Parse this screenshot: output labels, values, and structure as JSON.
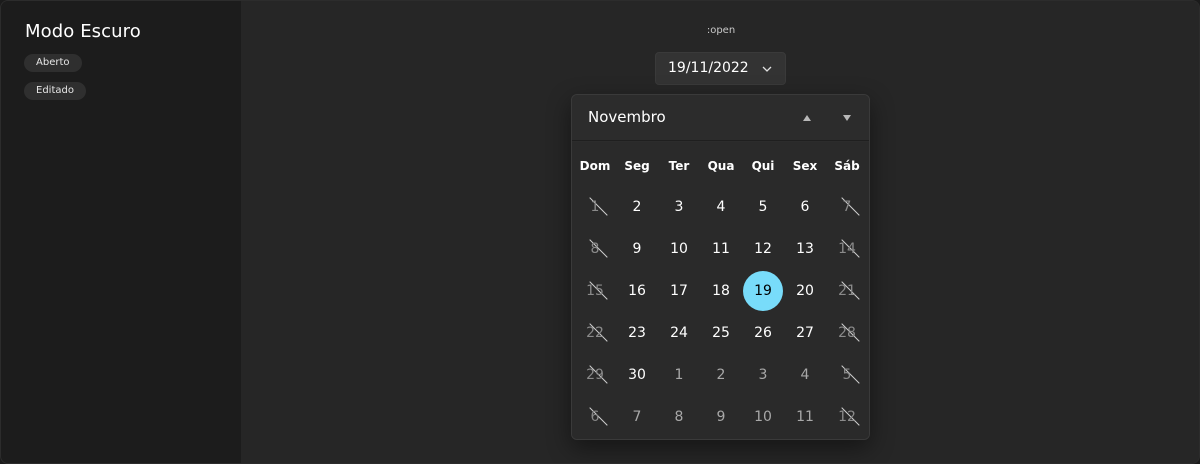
{
  "sidebar": {
    "title": "Modo Escuro",
    "chips": [
      "Aberto",
      "Editado"
    ]
  },
  "main": {
    "state_label": ":open"
  },
  "date_picker": {
    "value": "19/11/2022",
    "chevron_icon": "chevron-down-icon"
  },
  "calendar": {
    "month": "Novembro",
    "nav_up_icon": "caret-up-icon",
    "nav_down_icon": "caret-down-icon",
    "weekdays": [
      "Dom",
      "Seg",
      "Ter",
      "Qua",
      "Qui",
      "Sex",
      "Sáb"
    ],
    "selected_color": "#78dcfa",
    "weeks": [
      [
        {
          "d": "1",
          "state": "blackout"
        },
        {
          "d": "2",
          "state": "normal"
        },
        {
          "d": "3",
          "state": "normal"
        },
        {
          "d": "4",
          "state": "normal"
        },
        {
          "d": "5",
          "state": "normal"
        },
        {
          "d": "6",
          "state": "normal"
        },
        {
          "d": "7",
          "state": "blackout"
        }
      ],
      [
        {
          "d": "8",
          "state": "blackout"
        },
        {
          "d": "9",
          "state": "normal"
        },
        {
          "d": "10",
          "state": "normal"
        },
        {
          "d": "11",
          "state": "normal"
        },
        {
          "d": "12",
          "state": "normal"
        },
        {
          "d": "13",
          "state": "normal"
        },
        {
          "d": "14",
          "state": "blackout"
        }
      ],
      [
        {
          "d": "15",
          "state": "blackout"
        },
        {
          "d": "16",
          "state": "normal"
        },
        {
          "d": "17",
          "state": "normal"
        },
        {
          "d": "18",
          "state": "normal"
        },
        {
          "d": "19",
          "state": "selected"
        },
        {
          "d": "20",
          "state": "normal"
        },
        {
          "d": "21",
          "state": "blackout"
        }
      ],
      [
        {
          "d": "22",
          "state": "blackout"
        },
        {
          "d": "23",
          "state": "normal"
        },
        {
          "d": "24",
          "state": "normal"
        },
        {
          "d": "25",
          "state": "normal"
        },
        {
          "d": "26",
          "state": "normal"
        },
        {
          "d": "27",
          "state": "normal"
        },
        {
          "d": "28",
          "state": "blackout"
        }
      ],
      [
        {
          "d": "29",
          "state": "blackout"
        },
        {
          "d": "30",
          "state": "normal"
        },
        {
          "d": "1",
          "state": "outside"
        },
        {
          "d": "2",
          "state": "outside"
        },
        {
          "d": "3",
          "state": "outside"
        },
        {
          "d": "4",
          "state": "outside"
        },
        {
          "d": "5",
          "state": "blackout"
        }
      ],
      [
        {
          "d": "6",
          "state": "blackout"
        },
        {
          "d": "7",
          "state": "outside"
        },
        {
          "d": "8",
          "state": "outside"
        },
        {
          "d": "9",
          "state": "outside"
        },
        {
          "d": "10",
          "state": "outside"
        },
        {
          "d": "11",
          "state": "outside"
        },
        {
          "d": "12",
          "state": "blackout"
        }
      ]
    ]
  }
}
